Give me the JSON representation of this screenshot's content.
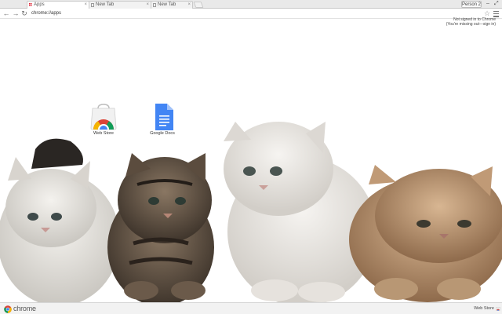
{
  "window": {
    "tabs": [
      {
        "title": "Apps",
        "active": true
      },
      {
        "title": "New Tab",
        "active": false
      },
      {
        "title": "New Tab",
        "active": false
      }
    ],
    "person_label": "Person 2"
  },
  "toolbar": {
    "url": "chrome://apps"
  },
  "signin": {
    "line1": "Not signed in to Chrome",
    "line2": "(You're missing out—sign in)"
  },
  "apps": [
    {
      "label": "Web Store",
      "icon": "web-store-icon"
    },
    {
      "label": "Google Docs",
      "icon": "google-docs-icon"
    }
  ],
  "bottombar": {
    "brand": "chrome",
    "webstore_label": "Web Store"
  },
  "colors": {
    "chrome_red": "#db4437",
    "chrome_yellow": "#f4b400",
    "chrome_green": "#0f9d58",
    "chrome_blue": "#4285f4",
    "docs_blue": "#4285f4"
  }
}
